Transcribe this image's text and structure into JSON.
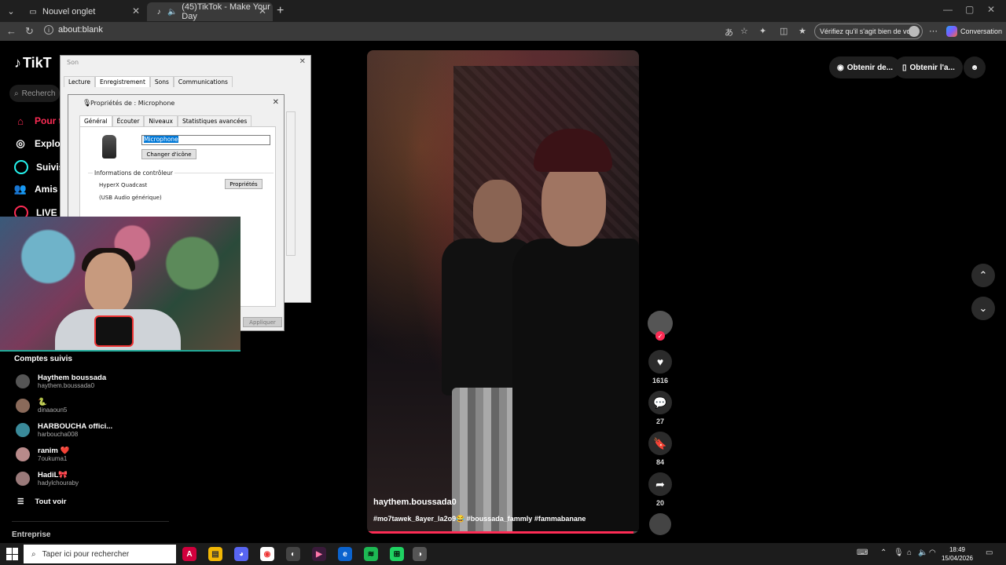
{
  "browser": {
    "tabs": [
      {
        "label": "Nouvel onglet",
        "icon": "new-tab-icon"
      },
      {
        "label": "(45)TikTok - Make Your Day",
        "icon": "tiktok-icon"
      }
    ],
    "url": "about:blank",
    "verify_label": "Vérifiez qu'il s'agit bien de vous",
    "copilot_label": "Conversation"
  },
  "tiktok": {
    "logo": "TikT",
    "search_placeholder": "Recherch",
    "nav": [
      {
        "label": "Pour t",
        "icon": "home-icon"
      },
      {
        "label": "Explo",
        "icon": "compass-icon"
      },
      {
        "label": "Suivis",
        "icon": "following-icon"
      },
      {
        "label": "Amis",
        "icon": "friends-icon"
      },
      {
        "label": "LIVE",
        "icon": "live-icon"
      }
    ],
    "following_title": "Comptes suivis",
    "following": [
      {
        "name": "Haythem boussada",
        "handle": "haythem.boussada0"
      },
      {
        "name": "🐍",
        "handle": "dinaaoun5"
      },
      {
        "name": "HARBOUCHA offici...",
        "handle": "harboucha008"
      },
      {
        "name": "ranim ❤️",
        "handle": "7oukuma1"
      },
      {
        "name": "HadiL🎀",
        "handle": "hadylchouraby"
      }
    ],
    "see_all": "Tout voir",
    "enterprise": "Entreprise",
    "top_buttons": [
      "Obtenir de...",
      "Obtenir l'a..."
    ],
    "video": {
      "username": "haythem.boussada0",
      "caption": "#mo7tawek_8ayer_la2o9😂 #boussada_fammly #fammabanane",
      "progress": 0.98
    },
    "actions": {
      "likes": "1616",
      "comments": "27",
      "saves": "84",
      "shares": "20"
    }
  },
  "dialogs": {
    "son": {
      "title": "Son",
      "tabs": [
        "Lecture",
        "Enregistrement",
        "Sons",
        "Communications"
      ],
      "selected_tab": "Enregistrement"
    },
    "mic": {
      "title": "Propriétés de : Microphone",
      "tabs": [
        "Général",
        "Écouter",
        "Niveaux",
        "Statistiques avancées"
      ],
      "name_value": "Microphone",
      "change_icon": "Changer d'icône",
      "controller_title": "Informations de contrôleur",
      "controller_name": "HyperX Quadcast",
      "controller_sub": "(USB Audio générique)",
      "properties_btn": "Propriétés",
      "apply_btn": "Appliquer",
      "apply_btn_back": "Appliquer"
    }
  },
  "taskbar": {
    "search_placeholder": "Taper ici pour rechercher",
    "time": "18:49",
    "date": "15/04/2026"
  }
}
